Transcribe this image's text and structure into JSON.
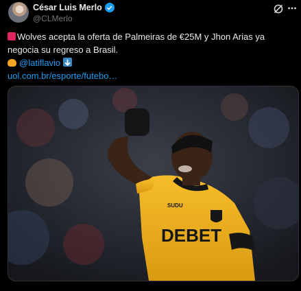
{
  "author": {
    "name": "César Luis Merlo",
    "handle": "@CLMerlo",
    "verified": true
  },
  "tweet": {
    "line1": "Wolves acepta la oferta de Palmeiras de €25M y Jhon Arias ya",
    "line2": "negocia su regreso a Brasil.",
    "mention": "@latiflavio",
    "link": "uol.com.br/esporte/futebo…"
  },
  "media": {
    "shirt_sponsor": "DEBET",
    "kit_brand": "SUDU"
  },
  "colors": {
    "background": "#000000",
    "text": "#e7e9ea",
    "secondary": "#71767b",
    "accent": "#1d9bf0",
    "kit": "#f2b21c"
  },
  "icons": [
    "verified-badge-icon",
    "grok-icon",
    "more-icon",
    "siren-icon",
    "handshake-icon",
    "down-arrow-icon"
  ]
}
